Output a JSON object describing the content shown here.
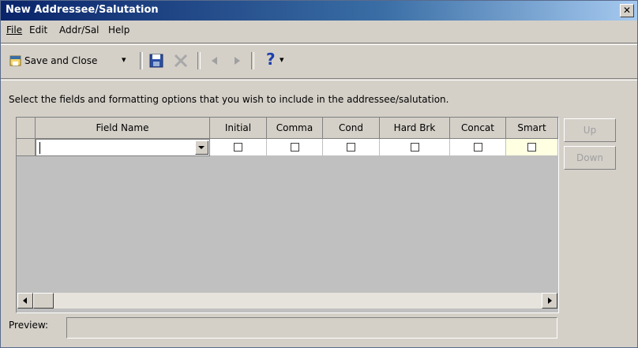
{
  "window": {
    "title": "New Addressee/Salutation",
    "close_glyph": "✕"
  },
  "menu": [
    {
      "label": "File"
    },
    {
      "label": "Edit"
    },
    {
      "label": "Addr/Sal"
    },
    {
      "label": "Help"
    }
  ],
  "toolbar": {
    "save_close_label": "Save and Close",
    "dropdown_glyph": "▾",
    "help_glyph": "?"
  },
  "instructions": "Select the fields and formatting options that you wish to include in the addressee/salutation.",
  "grid": {
    "columns": [
      {
        "key": "field_name",
        "label": "Field Name"
      },
      {
        "key": "initial",
        "label": "Initial"
      },
      {
        "key": "comma",
        "label": "Comma"
      },
      {
        "key": "cond",
        "label": "Cond"
      },
      {
        "key": "hard_brk",
        "label": "Hard Brk"
      },
      {
        "key": "concat",
        "label": "Concat"
      },
      {
        "key": "smart",
        "label": "Smart"
      }
    ],
    "row": {
      "field_name": "",
      "initial": false,
      "comma": false,
      "cond": false,
      "hard_brk": false,
      "concat": false,
      "smart": false
    }
  },
  "buttons": {
    "up": "Up",
    "down": "Down"
  },
  "preview": {
    "label": "Preview:",
    "value": ""
  },
  "colors": {
    "title_bar": "#0a246a",
    "selected_cell": "#ffffe1"
  }
}
